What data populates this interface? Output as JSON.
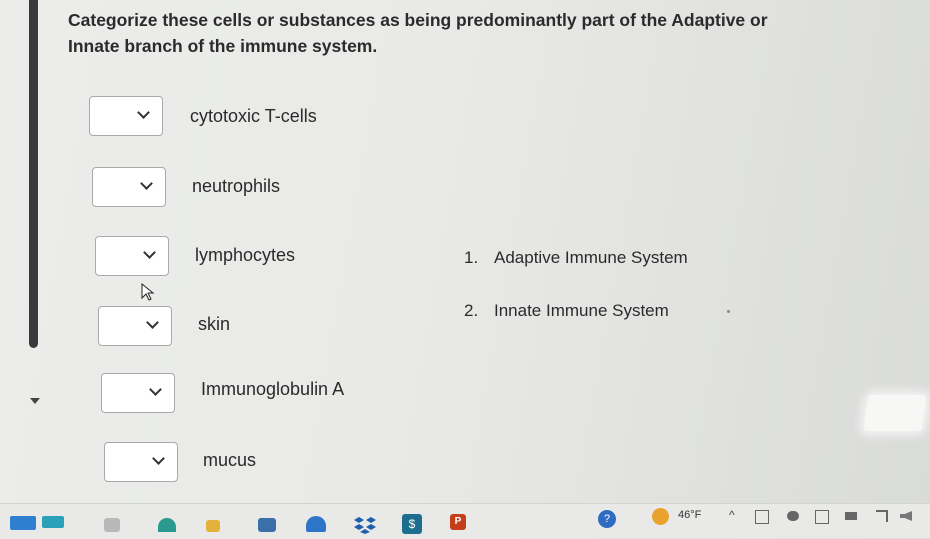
{
  "question": "Categorize these cells or substances as being predominantly part of the Adaptive or Innate branch of the immune system.",
  "items": [
    {
      "label": "cytotoxic T-cells",
      "selected": ""
    },
    {
      "label": "neutrophils",
      "selected": ""
    },
    {
      "label": "lymphocytes",
      "selected": ""
    },
    {
      "label": "skin",
      "selected": ""
    },
    {
      "label": "Immunoglobulin A",
      "selected": ""
    },
    {
      "label": "mucus",
      "selected": ""
    }
  ],
  "options": [
    {
      "number": "1.",
      "label": "Adaptive Immune System"
    },
    {
      "number": "2.",
      "label": "Innate Immune System"
    }
  ],
  "taskbar": {
    "weather_temp": "46°F",
    "tray_chevron": "^",
    "icons": [
      "windows-icon",
      "edge-icon",
      "file-explorer-icon",
      "store-icon",
      "teams-icon",
      "dropbox-icon",
      "money-icon",
      "powerpoint-icon",
      "help-icon"
    ]
  },
  "colors": {
    "background": "#e9eae8",
    "dropdown_border": "#a9a9a9",
    "sun": "#e9a32d",
    "powerpoint": "#c43e1c",
    "money": "#1e6f8f"
  }
}
